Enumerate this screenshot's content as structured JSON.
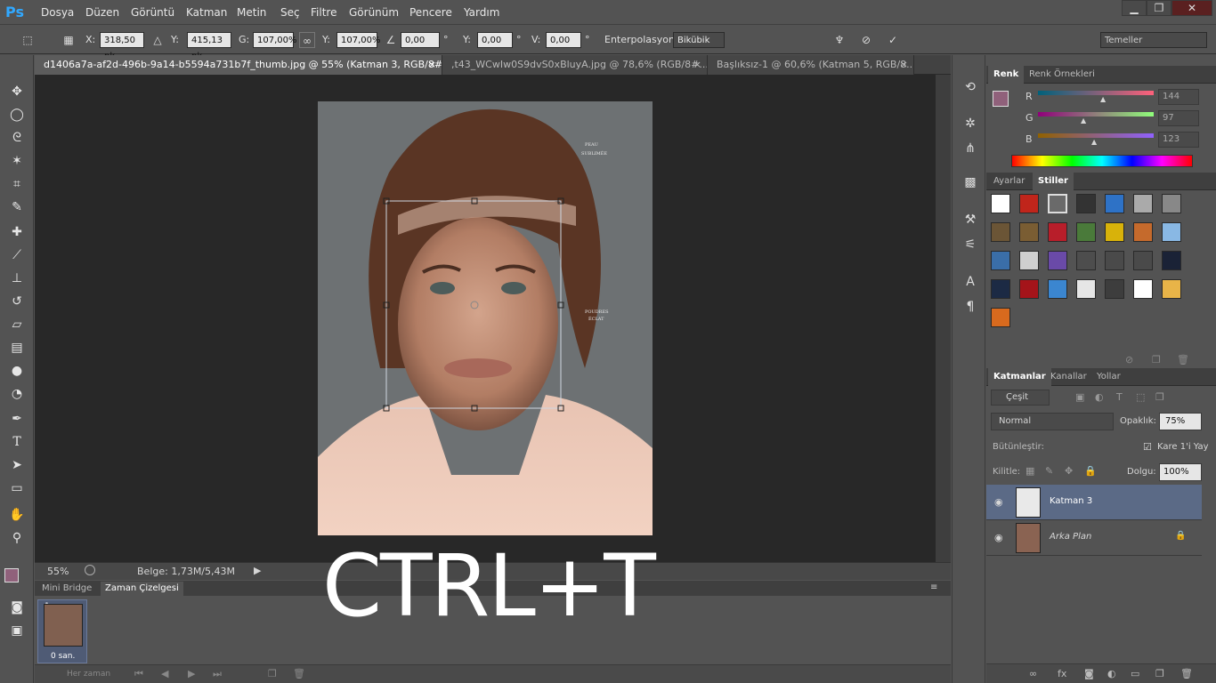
{
  "app": {
    "logo": "Ps"
  },
  "menu": [
    "Dosya",
    "Düzen",
    "Görüntü",
    "Katman",
    "Metin",
    "Seç",
    "Filtre",
    "Görünüm",
    "Pencere",
    "Yardım"
  ],
  "window_controls": {
    "minimize": "▁",
    "restore": "❐",
    "close": "✕"
  },
  "options": {
    "x_label": "X:",
    "x_value": "318,50 pk",
    "y_label": "Y:",
    "y_value": "415,13 pk",
    "w_label": "G:",
    "w_value": "107,00%",
    "h_label": "Y:",
    "h_value": "107,00%",
    "angle_value": "0,00",
    "angle_unit": "°",
    "hskew_label": "Y:",
    "hskew_value": "0,00",
    "hskew_unit": "°",
    "vskew_label": "V:",
    "vskew_value": "0,00",
    "vskew_unit": "°",
    "interp_label": "Enterpolasyon:",
    "interp_value": "Bikübik",
    "workspace": "Temeller"
  },
  "doc_tabs": [
    {
      "label": "d1406a7a-af2d-496b-9a14-b5594a731b7f_thumb.jpg @ 55% (Katman 3, RGB/8#) *"
    },
    {
      "label": ",t43_WCwIw0S9dvS0xBluyA.jpg @ 78,6% (RGB/8#..."
    },
    {
      "label": "Başlıksız-1 @ 60,6% (Katman 5, RGB/8..."
    }
  ],
  "status": {
    "zoom": "55%",
    "doc_info": "Belge: 1,73M/5,43M"
  },
  "bottom_panel": {
    "tabs": [
      "Mini Bridge",
      "Zaman Çizelgesi"
    ],
    "frame_number": "1",
    "frame_delay": "0 san.",
    "loop": "Her zaman"
  },
  "overlay_text": "CTRL+T",
  "color_panel": {
    "tabs": [
      "Renk",
      "Renk Örnekleri"
    ],
    "r_label": "R",
    "r_value": "144",
    "g_label": "G",
    "g_value": "97",
    "b_label": "B",
    "b_value": "123",
    "foreground": "#90617b"
  },
  "styles_panel": {
    "tabs": [
      "Ayarlar",
      "Stiller"
    ]
  },
  "layers_panel": {
    "tabs": [
      "Katmanlar",
      "Kanallar",
      "Yollar"
    ],
    "filter_label": "Çeşit",
    "blend_mode": "Normal",
    "opacity_label": "Opaklık:",
    "opacity_value": "75%",
    "unify_label": "Bütünleştir:",
    "propagate_label": "Kare 1'i Yay",
    "lock_label": "Kilitle:",
    "fill_label": "Dolgu:",
    "fill_value": "100%",
    "layers": [
      {
        "name": "Katman 3",
        "selected": true
      },
      {
        "name": "Arka Plan",
        "selected": false
      }
    ]
  },
  "colors": {
    "accent": "#31a8ff",
    "selection": "#5b6a86"
  }
}
